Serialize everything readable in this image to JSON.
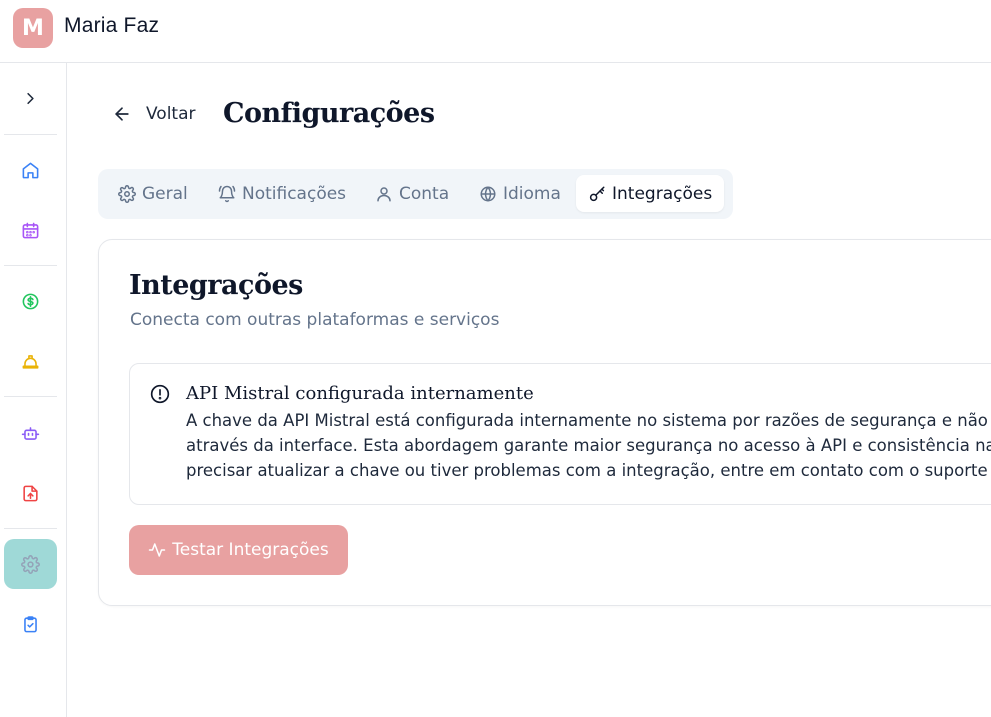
{
  "user": {
    "initial": "M",
    "name": "Maria Faz"
  },
  "sidebar": {
    "items": [
      {
        "icon": "chevron-right-icon"
      },
      {
        "icon": "home-icon",
        "color": "#3b82f6"
      },
      {
        "icon": "calendar-icon",
        "color": "#a855f7"
      },
      {
        "icon": "dollar-icon",
        "color": "#22c55e"
      },
      {
        "icon": "hard-hat-icon",
        "color": "#eab308"
      },
      {
        "icon": "bot-icon",
        "color": "#8b5cf6"
      },
      {
        "icon": "file-upload-icon",
        "color": "#ef4444"
      },
      {
        "icon": "gear-icon",
        "color": "#94a3b8",
        "active": true
      },
      {
        "icon": "clipboard-check-icon",
        "color": "#3b82f6"
      }
    ]
  },
  "header": {
    "back_label": "Voltar",
    "title": "Configurações"
  },
  "tabs": [
    {
      "label": "Geral",
      "icon": "gear-icon"
    },
    {
      "label": "Notificações",
      "icon": "bell-icon"
    },
    {
      "label": "Conta",
      "icon": "user-icon"
    },
    {
      "label": "Idioma",
      "icon": "globe-icon"
    },
    {
      "label": "Integrações",
      "icon": "key-icon",
      "active": true
    }
  ],
  "section": {
    "title": "Integrações",
    "subtitle": "Conecta com outras plataformas e serviços",
    "alert": {
      "icon": "info-circle-icon",
      "title": "API Mistral configurada internamente",
      "lines": [
        "A chave da API Mistral está configurada internamente no sistema por razões de segurança e não po",
        "através da interface. Esta abordagem garante maior segurança no acesso à API e consistência na in",
        "precisar atualizar a chave ou tiver problemas com a integração, entre em contato com o suporte téc"
      ]
    },
    "test_button": {
      "label": "Testar Integrações",
      "icon": "activity-icon"
    }
  },
  "colors": {
    "brand": "#e8a1a1",
    "active_nav": "#9fd9d7",
    "tab_bg": "#f1f5f9"
  }
}
